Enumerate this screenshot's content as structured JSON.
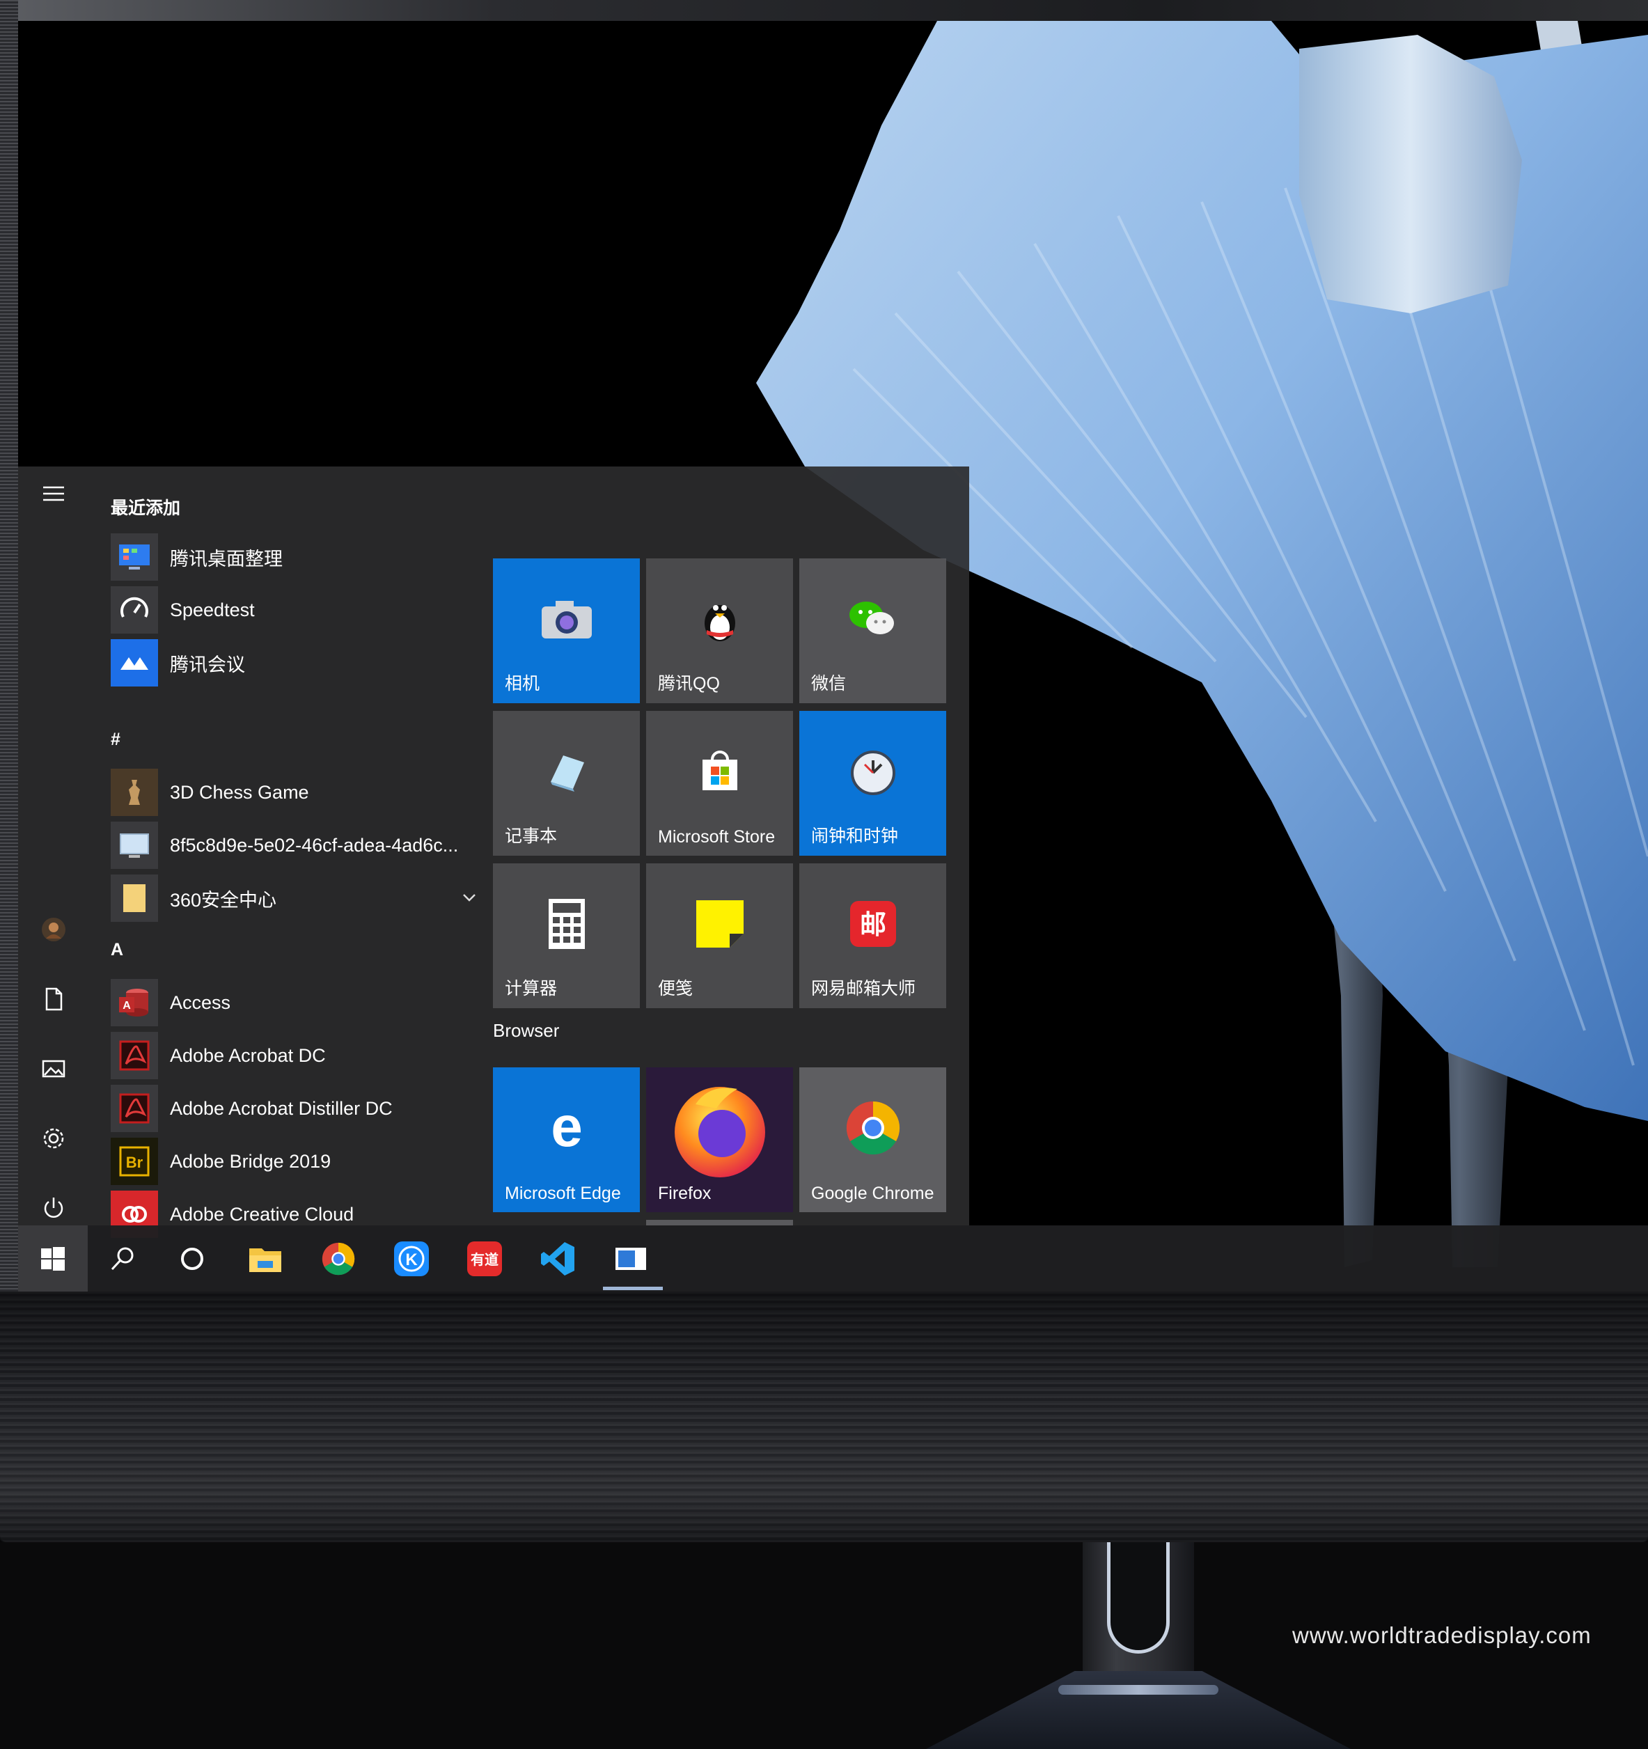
{
  "start_menu": {
    "recent_heading": "最近添加",
    "recent_apps": [
      {
        "label": "腾讯桌面整理",
        "icon": "tencent-desktop-organizer-icon"
      },
      {
        "label": "Speedtest",
        "icon": "speedtest-icon"
      },
      {
        "label": "腾讯会议",
        "icon": "tencent-meeting-icon"
      }
    ],
    "hash_heading": "#",
    "hash_apps": [
      {
        "label": "3D Chess Game",
        "icon": "chess-game-icon"
      },
      {
        "label": "8f5c8d9e-5e02-46cf-adea-4ad6c...",
        "icon": "generic-app-icon"
      },
      {
        "label": "360安全中心",
        "icon": "folder-icon"
      }
    ],
    "a_heading": "A",
    "a_apps": [
      {
        "label": "Access",
        "icon": "access-icon"
      },
      {
        "label": "Adobe Acrobat DC",
        "icon": "acrobat-icon"
      },
      {
        "label": "Adobe Acrobat Distiller DC",
        "icon": "acrobat-distiller-icon"
      },
      {
        "label": "Adobe Bridge 2019",
        "icon": "bridge-icon"
      },
      {
        "label": "Adobe Creative Cloud",
        "icon": "creative-cloud-icon"
      }
    ],
    "tiles": [
      {
        "label": "相机",
        "icon": "camera-icon"
      },
      {
        "label": "腾讯QQ",
        "icon": "qq-penguin-icon"
      },
      {
        "label": "微信",
        "icon": "wechat-icon"
      },
      {
        "label": "记事本",
        "icon": "notepad-icon"
      },
      {
        "label": "Microsoft Store",
        "icon": "store-icon"
      },
      {
        "label": "闹钟和时钟",
        "icon": "alarm-clock-icon"
      },
      {
        "label": "计算器",
        "icon": "calculator-icon"
      },
      {
        "label": "便笺",
        "icon": "sticky-notes-icon"
      },
      {
        "label": "网易邮箱大师",
        "icon": "netease-mail-icon"
      }
    ],
    "browser_group": {
      "heading": "Browser",
      "tiles": [
        {
          "label": "Microsoft Edge",
          "icon": "edge-icon"
        },
        {
          "label": "Firefox",
          "icon": "firefox-icon"
        },
        {
          "label": "Google Chrome",
          "icon": "chrome-icon"
        }
      ]
    }
  },
  "taskbar": {
    "items": [
      "windows-start-icon",
      "search-icon",
      "cortana-icon",
      "file-explorer-icon",
      "chrome-icon",
      "kugou-icon",
      "youdao-icon",
      "vscode-icon",
      "app-window-icon"
    ],
    "youdao_text": "有道",
    "kugou_text": "K"
  },
  "colors": {
    "accent_blue": "#0a74d6",
    "tile_gray": "#4a4a4c",
    "menu_bg": "#2b2b2d",
    "taskbar_bg": "#1f1f21"
  },
  "watermark": "www.worldtradedisplay.com"
}
